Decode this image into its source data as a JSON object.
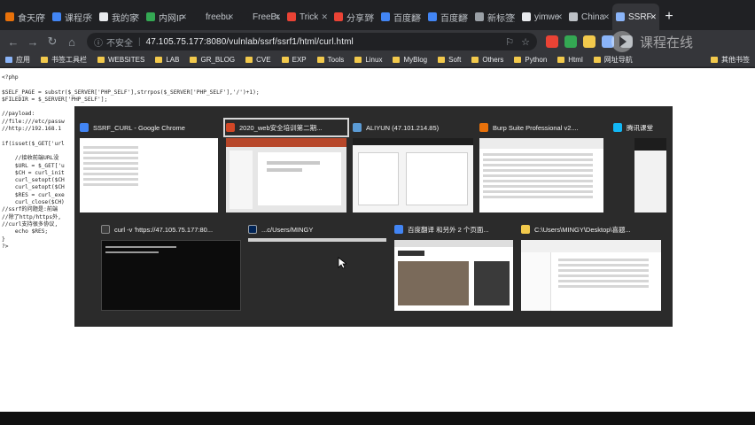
{
  "browser": {
    "tabs": [
      {
        "title": "食天府",
        "color": "#e8710a"
      },
      {
        "title": "课程乐",
        "color": "#4285f4"
      },
      {
        "title": "我的家",
        "color": "#e8eaed"
      },
      {
        "title": "内网IP",
        "color": "#34a853"
      },
      {
        "title": "freebu",
        "color": "#202124"
      },
      {
        "title": "FreeBu",
        "color": "#202124"
      },
      {
        "title": "Trick",
        "color": "#ea4335"
      },
      {
        "title": "分享到",
        "color": "#ea4335"
      },
      {
        "title": "百度翻",
        "color": "#4285f4"
      },
      {
        "title": "百度翻",
        "color": "#4285f4"
      },
      {
        "title": "新标签页",
        "color": "#9aa0a6"
      },
      {
        "title": "yimwe",
        "color": "#e8eaed"
      },
      {
        "title": "China",
        "color": "#bdc1c6"
      },
      {
        "title": "SSRF",
        "color": "#8ab4f8",
        "active": true
      }
    ],
    "new_tab": "+",
    "nav": {
      "back": "←",
      "forward": "→",
      "reload": "↻",
      "home": "⌂"
    },
    "omnibox": {
      "security": "不安全",
      "url": "47.105.75.177:8080/vulnlab/ssrf/ssrf1/html/curl.html",
      "info_icon": "ⓘ",
      "bookmark_star": "☆"
    },
    "watermark": "课程在线",
    "bookmarks": [
      {
        "label": "应用",
        "icon": "grid"
      },
      {
        "label": "书签工具栏",
        "icon": "folder"
      },
      {
        "label": "WEBSITES",
        "icon": "folder"
      },
      {
        "label": "LAB",
        "icon": "folder"
      },
      {
        "label": "GR_BLOG",
        "icon": "folder"
      },
      {
        "label": "CVE",
        "icon": "folder"
      },
      {
        "label": "EXP",
        "icon": "folder"
      },
      {
        "label": "Tools",
        "icon": "folder"
      },
      {
        "label": "Linux",
        "icon": "folder"
      },
      {
        "label": "MyBlog",
        "icon": "folder"
      },
      {
        "label": "Soft",
        "icon": "folder"
      },
      {
        "label": "Others",
        "icon": "folder"
      },
      {
        "label": "Python",
        "icon": "folder"
      },
      {
        "label": "Html",
        "icon": "folder"
      },
      {
        "label": "网址导航",
        "icon": "folder"
      }
    ],
    "bookmarks_other": "其他书签"
  },
  "page": {
    "code_lines": [
      "<?php",
      "",
      "$SELF_PAGE = substr($_SERVER['PHP_SELF'],strrpos($_SERVER['PHP_SELF'],'/')+1);",
      "$FILEDIR = $_SERVER['PHP_SELF'];",
      "",
      "//payload:",
      "//file:///etc/passw",
      "//http://192.168.1",
      "",
      "if(isset($_GET['url",
      "",
      "    //接收前端URL没",
      "    $URL = $_GET['u",
      "    $CH = curl_init",
      "    curl_setopt($CH",
      "    curl_setopt($CH",
      "    $RES = curl_exe",
      "    curl_close($CH)",
      "//ssrf的问题是:前端",
      "//除了http/https外,",
      "//curl支持很多协议,",
      "    echo $RES;",
      "}",
      "?>"
    ]
  },
  "switcher": {
    "windows": [
      {
        "title": "SSRF_CURL - Google Chrome",
        "icon": "chrome-icon",
        "selected": false
      },
      {
        "title": "2020_web安全培训第二期...",
        "icon": "powerpoint-icon",
        "selected": true
      },
      {
        "title": "ALIYUN (47.101.214.85)",
        "icon": "remote-desktop-icon",
        "selected": false
      },
      {
        "title": "Burp Suite Professional v2....",
        "icon": "burp-icon",
        "selected": false
      },
      {
        "title": "腾讯课堂",
        "icon": "tencent-class-icon",
        "selected": false
      },
      {
        "title": "curl -v 'https://47.105.75.177:80...",
        "icon": "terminal-icon",
        "selected": false
      },
      {
        "title": "...c/Users/MINGY",
        "icon": "console-icon",
        "selected": false
      },
      {
        "title": "百度翻译 和另外 2 个页面...",
        "icon": "chrome-icon",
        "selected": false
      },
      {
        "title": "C:\\Users\\MINGY\\Desktop\\喜题...",
        "icon": "explorer-icon",
        "selected": false
      }
    ]
  }
}
